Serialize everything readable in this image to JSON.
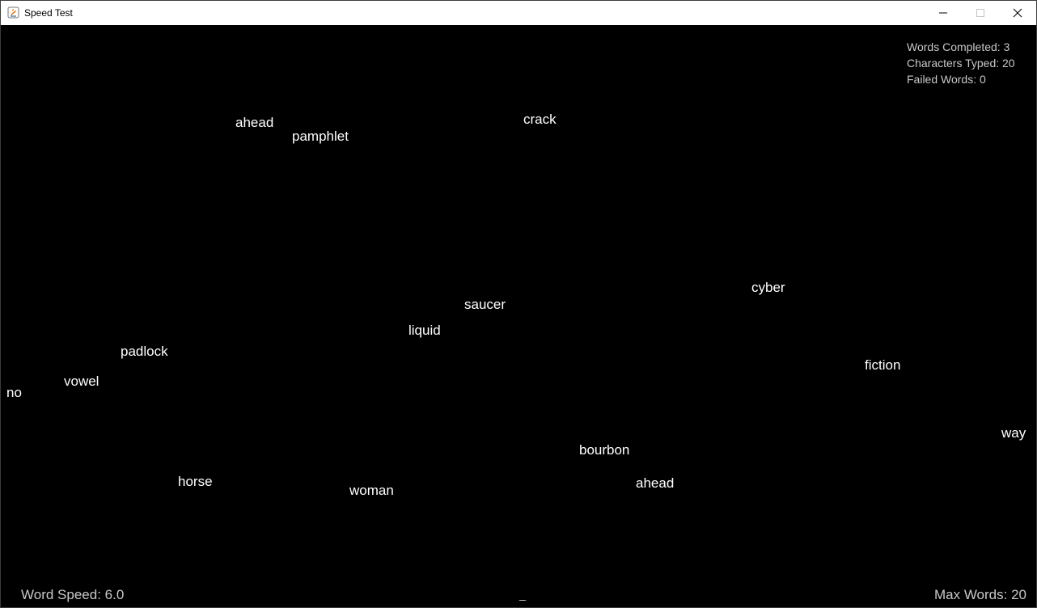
{
  "window": {
    "title": "Speed Test",
    "controls": {
      "minimize": "minimize",
      "maximize": "maximize",
      "close": "close"
    }
  },
  "stats": {
    "words_completed": "Words Completed: 3",
    "characters_typed": "Characters Typed: 20",
    "failed_words": "Failed Words: 0"
  },
  "words": [
    "ahead",
    "pamphlet",
    "crack",
    "cyber",
    "saucer",
    "liquid",
    "padlock",
    "fiction",
    "vowel",
    "no",
    "way",
    "bourbon",
    "horse",
    "woman",
    "ahead"
  ],
  "footer": {
    "word_speed": "Word Speed: 6.0",
    "typed_text": "_",
    "max_words": "Max Words: 20"
  },
  "colors": {
    "background": "#000000",
    "word": "#ffffff",
    "info_text": "#c8c8c8"
  }
}
